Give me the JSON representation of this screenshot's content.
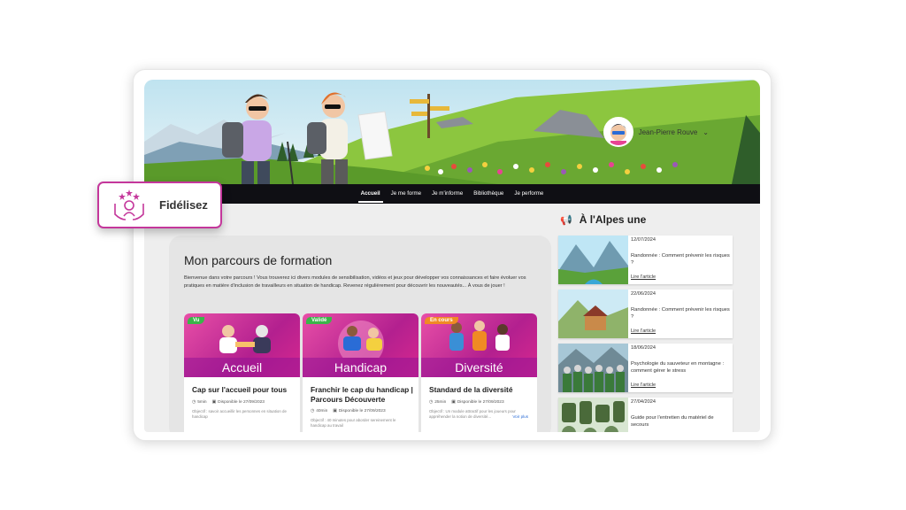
{
  "user": {
    "name": "Jean-Pierre Rouve"
  },
  "nav": {
    "items": [
      "Accueil",
      "Je me forme",
      "Je m'informe",
      "Bibliothèque",
      "Je performe"
    ]
  },
  "parcours": {
    "title": "Mon parcours de formation",
    "intro": "Bienvenue dans votre parcours ! Vous trouverez ici divers modules de sensibilisation, vidéos et jeux pour développer vos connaissances et faire évoluer vos pratiques en matière d'inclusion de travailleurs en situation de handicap. Revenez régulièrement pour découvrir les nouveautés... À vous de jouer !",
    "cards": [
      {
        "badge": "Vu",
        "badge_color": "#3ab54a",
        "image_word": "Accueil",
        "title": "Cap sur l'accueil pour tous",
        "duration": "5min",
        "available": "Disponible le 27/09/2023",
        "objective": "Objectif : savoir accueillir les personnes en situation de handicap"
      },
      {
        "badge": "Validé",
        "badge_color": "#3ab54a",
        "image_word": "Handicap",
        "title": "Franchir le cap du handicap | Parcours Découverte",
        "duration": "40min",
        "available": "Disponible le 27/09/2023",
        "objective": "Objectif : 40 minutes pour aborder sereinement le handicap au travail"
      },
      {
        "badge": "En cours",
        "badge_color": "#f08a24",
        "image_word": "Diversité",
        "title": "Standard de la diversité",
        "duration": "25min",
        "available": "Disponible le 27/09/2023",
        "objective": "Objectif : Un module attractif pour les joueurs pour appréhender la notion de diversité...",
        "more": "Voir plus"
      }
    ]
  },
  "news": {
    "title": "À l'Alpes une",
    "link_label": "Lire l'article",
    "items": [
      {
        "date": "12/07/2024",
        "text": "Randonnée : Comment prévenir les risques ?",
        "thumb": "mountains-river"
      },
      {
        "date": "22/06/2024",
        "text": "Randonnée : Comment prévenir les risques ?",
        "thumb": "mountain-chalet"
      },
      {
        "date": "18/06/2024",
        "text": "Psychologie du sauveteur en montagne : comment gérer le stress",
        "thumb": "rescuers-group"
      },
      {
        "date": "27/04/2024",
        "text": "Guide pour l'entretien du matériel de secours",
        "thumb": "rescue-equipment"
      }
    ]
  },
  "callout": {
    "label": "Fidélisez",
    "icon": "hands-stars-icon",
    "accent": "#c4379b"
  },
  "colors": {
    "nav_bg": "#0f0f14",
    "card_gradient": "#e84fa7",
    "accent": "#c4379b"
  }
}
